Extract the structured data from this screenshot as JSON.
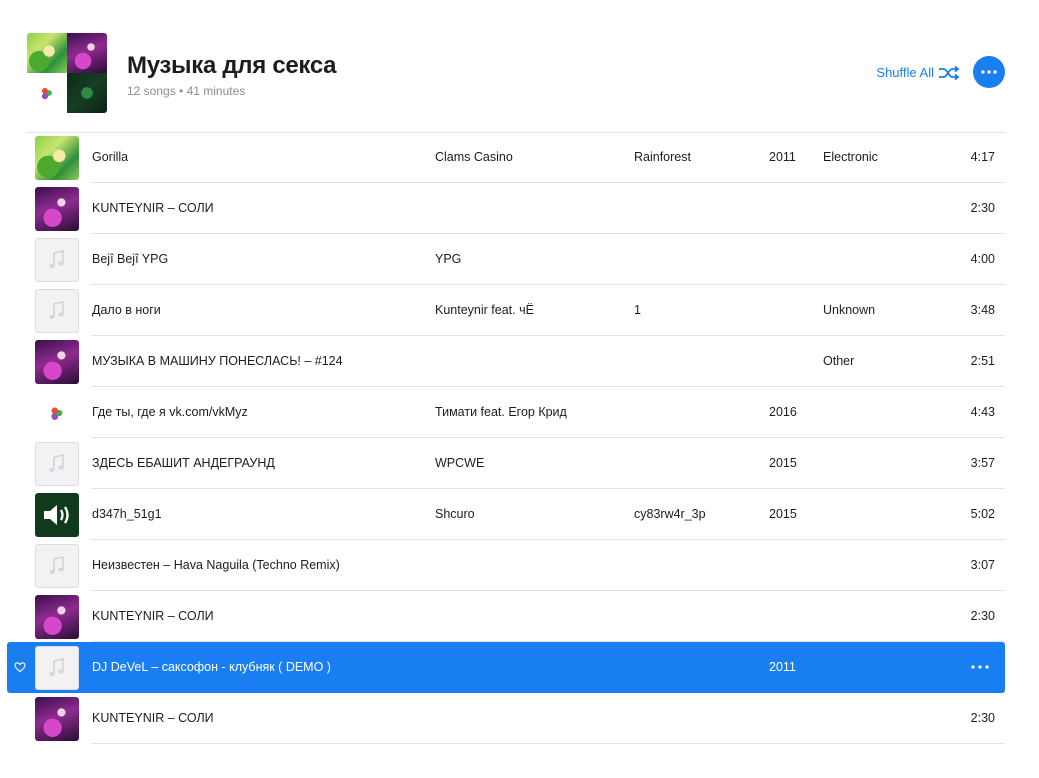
{
  "playlist": {
    "title": "Музыка для секса",
    "meta": "12 songs • 41 minutes",
    "shuffle_label": "Shuffle All",
    "cover_tiles": [
      "gorilla-art",
      "purple-art",
      "vkmyz-art",
      "dark-green-art"
    ]
  },
  "colors": {
    "accent": "#1a7ef3",
    "text": "#1d1d1f",
    "secondary": "#8e8e93",
    "divider": "#e3e3e6"
  },
  "tracks": [
    {
      "title": "Gorilla",
      "artist": "Clams Casino",
      "album": "Rainforest",
      "year": "2011",
      "genre": "Electronic",
      "time": "4:17",
      "art": "gorilla"
    },
    {
      "title": "KUNTEYNIR – СОЛИ",
      "artist": "",
      "album": "",
      "year": "",
      "genre": "",
      "time": "2:30",
      "art": "purple"
    },
    {
      "title": "Bejî Bejî YPG",
      "artist": "YPG",
      "album": "",
      "year": "",
      "genre": "",
      "time": "4:00",
      "art": "placeholder"
    },
    {
      "title": "Дало в ноги",
      "artist": "Kunteynir feat. чЁ",
      "album": "1",
      "year": "",
      "genre": "Unknown",
      "time": "3:48",
      "art": "placeholder"
    },
    {
      "title": "МУЗЫКА В МАШИНУ ПОНЕСЛАСЬ!   – #124",
      "artist": "",
      "album": "",
      "year": "",
      "genre": "Other",
      "time": "2:51",
      "art": "purple"
    },
    {
      "title": "Где ты, где я vk.com/vkMyz",
      "artist": "Тимати feat. Егор Крид",
      "album": "",
      "year": "2016",
      "genre": "",
      "time": "4:43",
      "art": "vkmyz"
    },
    {
      "title": "ЗДЕСЬ ЕБАШИТ АНДЕГРАУНД",
      "artist": "WPCWE",
      "album": "",
      "year": "2015",
      "genre": "",
      "time": "3:57",
      "art": "placeholder"
    },
    {
      "title": "d347h_51g1",
      "artist": "Shcuro",
      "album": "cy83rw4r_3p",
      "year": "2015",
      "genre": "",
      "time": "5:02",
      "art": "speaker"
    },
    {
      "title": "Неизвестен – Hava Naguila (Techno Remix)",
      "artist": "",
      "album": "",
      "year": "",
      "genre": "",
      "time": "3:07",
      "art": "placeholder"
    },
    {
      "title": "KUNTEYNIR – СОЛИ",
      "artist": "",
      "album": "",
      "year": "",
      "genre": "",
      "time": "2:30",
      "art": "purple"
    },
    {
      "title": "DJ DeVeL – саксофон - клубняк ( DEMO )",
      "artist": "",
      "album": "",
      "year": "2011",
      "genre": "",
      "time": "",
      "art": "placeholder",
      "selected": true
    },
    {
      "title": "KUNTEYNIR – СОЛИ",
      "artist": "",
      "album": "",
      "year": "",
      "genre": "",
      "time": "2:30",
      "art": "purple"
    }
  ],
  "icons": {
    "shuffle": "shuffle-icon",
    "more": "ellipsis-icon",
    "heart": "heart-icon",
    "note": "music-note-icon",
    "speaker": "speaker-icon"
  }
}
